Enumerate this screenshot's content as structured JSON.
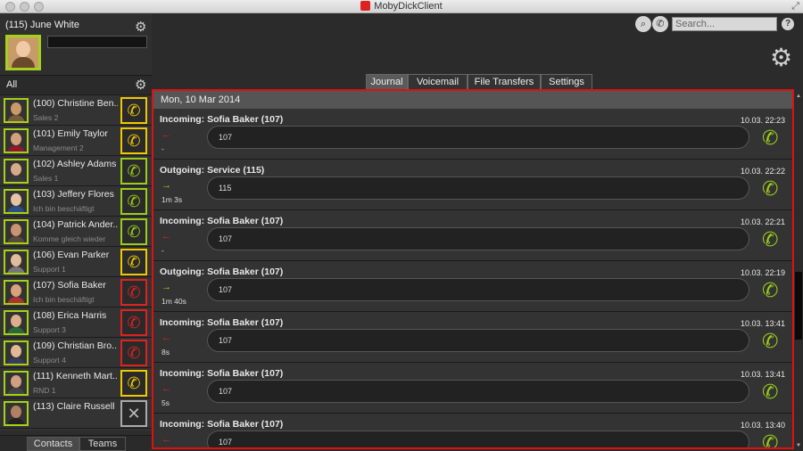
{
  "window": {
    "title": "MobyDickClient"
  },
  "me": {
    "name": "(115) June White",
    "status_text": ""
  },
  "group": {
    "label": "All"
  },
  "contacts": [
    {
      "name": "(100) Christine Ben...",
      "status": "Sales 2",
      "state": "yellow",
      "avatar_color": "#c79b67",
      "shirt": "#7a5b3a"
    },
    {
      "name": "(101) Emily Taylor",
      "status": "Management 2",
      "state": "yellow",
      "avatar_color": "#d3a07c",
      "shirt": "#8b1a2a"
    },
    {
      "name": "(102) Ashley Adams",
      "status": "Sales 1",
      "state": "green",
      "avatar_color": "#d9aa87",
      "shirt": "#3a3a3a"
    },
    {
      "name": "(103) Jeffery Flores",
      "status": "Ich bin beschäftigt",
      "state": "green",
      "avatar_color": "#e6c3a3",
      "shirt": "#2c4f8a"
    },
    {
      "name": "(104) Patrick Ander...",
      "status": "Komme gleich wieder",
      "state": "green",
      "avatar_color": "#c99472",
      "shirt": "#5a4a3a"
    },
    {
      "name": "(106) Evan Parker",
      "status": "Support 1",
      "state": "yellow",
      "avatar_color": "#e2bd9a",
      "shirt": "#777"
    },
    {
      "name": "(107) Sofia Baker",
      "status": "Ich bin beschäftigt",
      "state": "red",
      "avatar_color": "#d8a27c",
      "shirt": "#a33"
    },
    {
      "name": "(108) Erica Harris",
      "status": "Support 3",
      "state": "red",
      "avatar_color": "#dcae8a",
      "shirt": "#2a6a3a"
    },
    {
      "name": "(109) Christian Bro...",
      "status": "Support 4",
      "state": "red",
      "avatar_color": "#e1b995",
      "shirt": "#3a3a5a"
    },
    {
      "name": "(111) Kenneth Mart...",
      "status": "RND 1",
      "state": "yellow",
      "avatar_color": "#d0a080",
      "shirt": "#444"
    },
    {
      "name": "(113) Claire Russell",
      "status": "",
      "state": "grey",
      "avatar_color": "#b08060",
      "shirt": "#222"
    },
    {
      "name": "(113) Claire Russell",
      "status": "",
      "state": "yellow",
      "avatar_color": "#d5a884",
      "shirt": "#555"
    }
  ],
  "bottom_tabs": [
    "Contacts",
    "Teams"
  ],
  "search": {
    "placeholder": "Search..."
  },
  "tabs": [
    "Journal",
    "Voicemail",
    "File Transfers",
    "Settings"
  ],
  "journal": {
    "date": "Mon, 10 Mar 2014",
    "entries": [
      {
        "title": "Incoming: Sofia Baker (107)",
        "time": "10.03. 22:23",
        "direction": "in",
        "arrow": "←",
        "duration": "-",
        "number": "107"
      },
      {
        "title": "Outgoing: Service (115)",
        "time": "10.03. 22:22",
        "direction": "out",
        "arrow": "→",
        "duration": "1m 3s",
        "number": "115"
      },
      {
        "title": "Incoming: Sofia Baker (107)",
        "time": "10.03. 22:21",
        "direction": "in",
        "arrow": "←",
        "duration": "-",
        "number": "107"
      },
      {
        "title": "Outgoing: Sofia Baker (107)",
        "time": "10.03. 22:19",
        "direction": "out",
        "arrow": "→",
        "duration": "1m 40s",
        "number": "107"
      },
      {
        "title": "Incoming: Sofia Baker (107)",
        "time": "10.03. 13:41",
        "direction": "in",
        "arrow": "←",
        "duration": "8s",
        "number": "107"
      },
      {
        "title": "Incoming: Sofia Baker (107)",
        "time": "10.03. 13:41",
        "direction": "in",
        "arrow": "←",
        "duration": "5s",
        "number": "107"
      },
      {
        "title": "Incoming: Sofia Baker (107)",
        "time": "10.03. 13:40",
        "direction": "in",
        "arrow": "←",
        "duration": "",
        "number": "107"
      }
    ]
  },
  "icons": {
    "phone": "✆",
    "phone_off": "✕",
    "gear": "⚙",
    "search": "⌕",
    "help": "?",
    "resize": "⤢"
  }
}
